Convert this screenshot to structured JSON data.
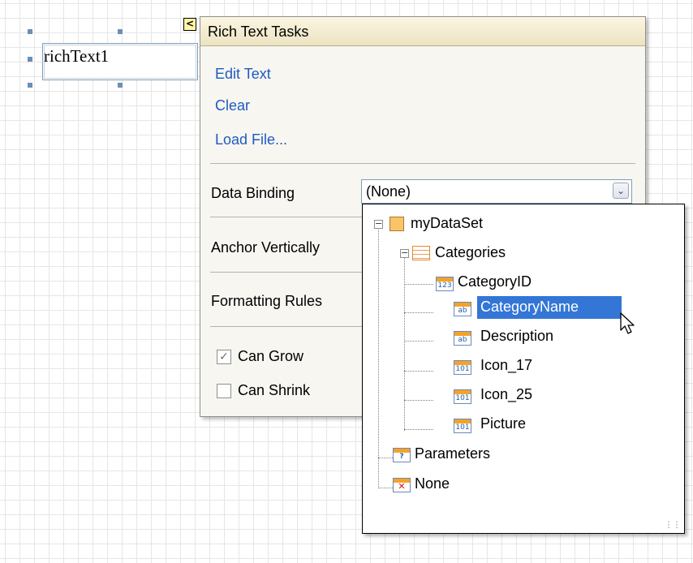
{
  "designer": {
    "control_label": "richText1"
  },
  "smart_tag": {
    "glyph": "<"
  },
  "tasks_panel": {
    "title": "Rich Text Tasks",
    "links": {
      "edit_text": "Edit Text",
      "clear": "Clear",
      "load_file": "Load File..."
    },
    "data_binding": {
      "label": "Data Binding",
      "value": "(None)"
    },
    "anchor_vertically": {
      "label": "Anchor Vertically"
    },
    "formatting_rules": {
      "label": "Formatting Rules"
    },
    "can_grow": {
      "label": "Can Grow",
      "checked": true
    },
    "can_shrink": {
      "label": "Can Shrink",
      "checked": false
    }
  },
  "binding_tree": {
    "root": "myDataSet",
    "table": "Categories",
    "fields": [
      {
        "label": "CategoryID",
        "icon": "123"
      },
      {
        "label": "CategoryName",
        "icon": "ab",
        "selected": true
      },
      {
        "label": "Description",
        "icon": "ab"
      },
      {
        "label": "Icon_17",
        "icon": "101"
      },
      {
        "label": "Icon_25",
        "icon": "101"
      },
      {
        "label": "Picture",
        "icon": "101"
      }
    ],
    "parameters": "Parameters",
    "none": "None"
  },
  "colors": {
    "link": "#1f5bbf",
    "selection": "#3376d6",
    "panel_bg": "#f7f6f1"
  }
}
